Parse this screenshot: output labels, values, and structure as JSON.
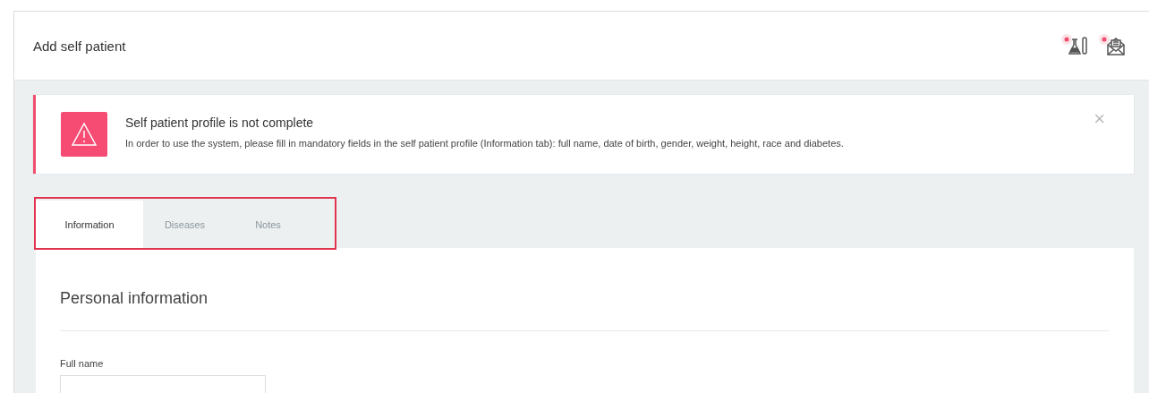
{
  "header": {
    "title": "Add self patient",
    "icons": [
      {
        "kind": "flask",
        "badge": true
      },
      {
        "kind": "mail",
        "badge": true
      }
    ]
  },
  "alert": {
    "title": "Self patient profile is not complete",
    "message": "In order to use the system, please fill in mandatory fields in the self patient profile (Information tab): full name, date of birth, gender, weight, height, race and diabetes.",
    "close": "×"
  },
  "tabs": [
    {
      "label": "Information",
      "selected": true
    },
    {
      "label": "Diseases",
      "selected": false
    },
    {
      "label": "Notes",
      "selected": false
    }
  ],
  "section": {
    "title": "Personal information",
    "fields": [
      {
        "label": "Full name"
      }
    ]
  }
}
